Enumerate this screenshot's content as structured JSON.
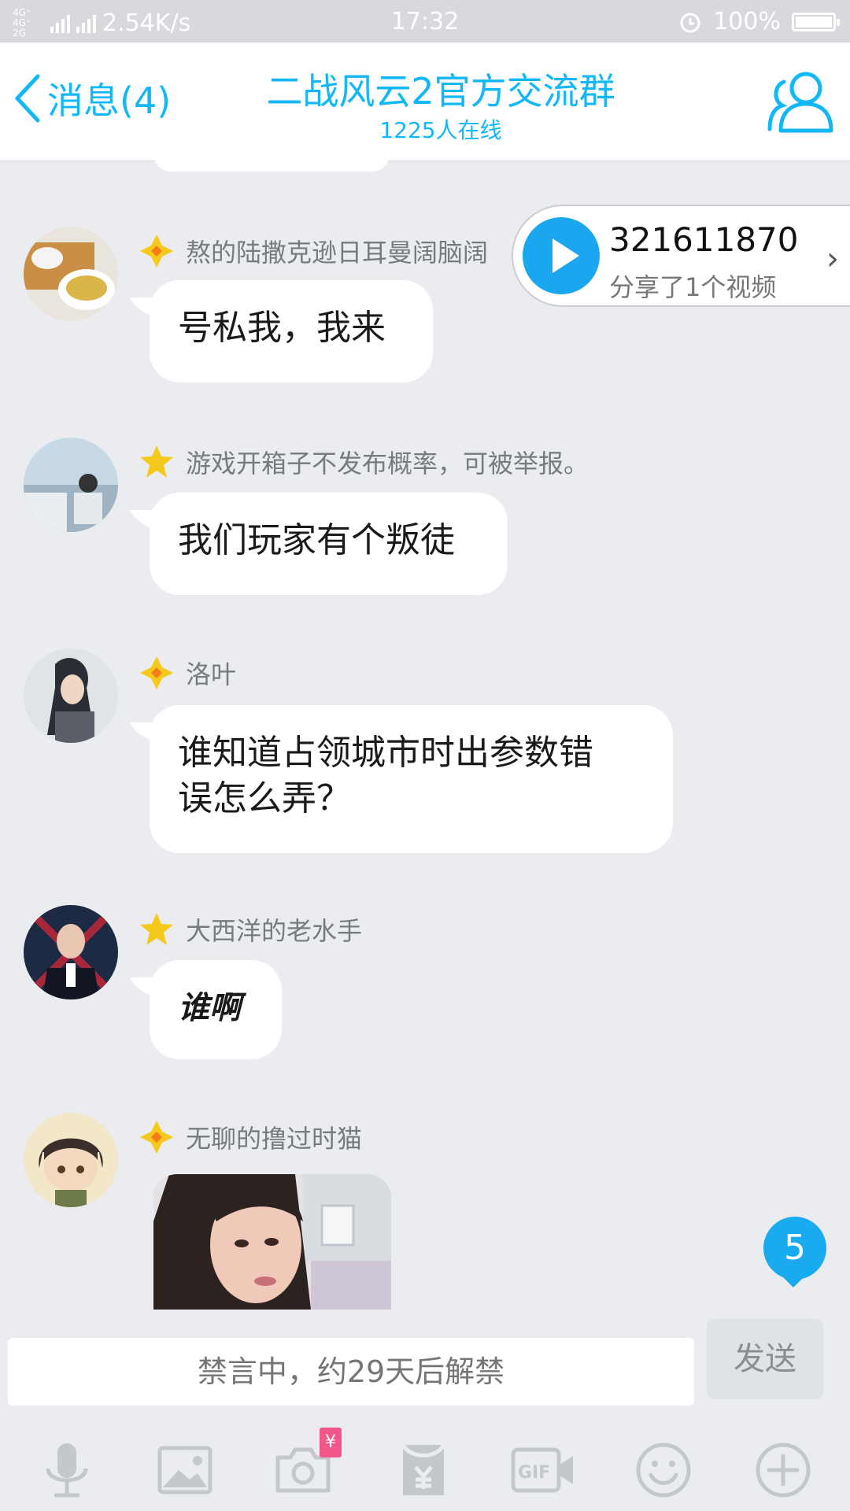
{
  "status_bar": {
    "network_types": "4G⁺ 4G⁺ 2G",
    "speed": "2.54K/s",
    "time": "17:32",
    "battery": "100%"
  },
  "header": {
    "back_label": "消息(4)",
    "title": "二战风云2官方交流群",
    "subtitle": "1225人在线"
  },
  "share_popup": {
    "number": "321611870",
    "description": "分享了1个视频"
  },
  "messages": [
    {
      "name": "熬的陆撒克逊日耳曼阔脑阔",
      "text": "号私我，我来"
    },
    {
      "name": "游戏开箱子不发布概率，可被举报。",
      "text": "我们玩家有个叛徒"
    },
    {
      "name": "洛叶",
      "text_line1": "谁知道占领城市时出参数错",
      "text_line2": "误怎么弄？"
    },
    {
      "name": "大西洋的老水手",
      "text": "谁啊"
    },
    {
      "name": "无聊的撸过时猫"
    }
  ],
  "unread_badge": "5",
  "input": {
    "placeholder": "禁言中，约29天后解禁",
    "send_label": "发送"
  },
  "toolbar": {
    "icons": [
      "microphone-icon",
      "image-icon",
      "camera-icon",
      "red-packet-icon",
      "gif-icon",
      "emoji-icon",
      "plus-icon"
    ],
    "camera_badge": "¥"
  },
  "colors": {
    "accent": "#12b7f5",
    "background": "#eaecf0",
    "bubble": "#ffffff"
  }
}
